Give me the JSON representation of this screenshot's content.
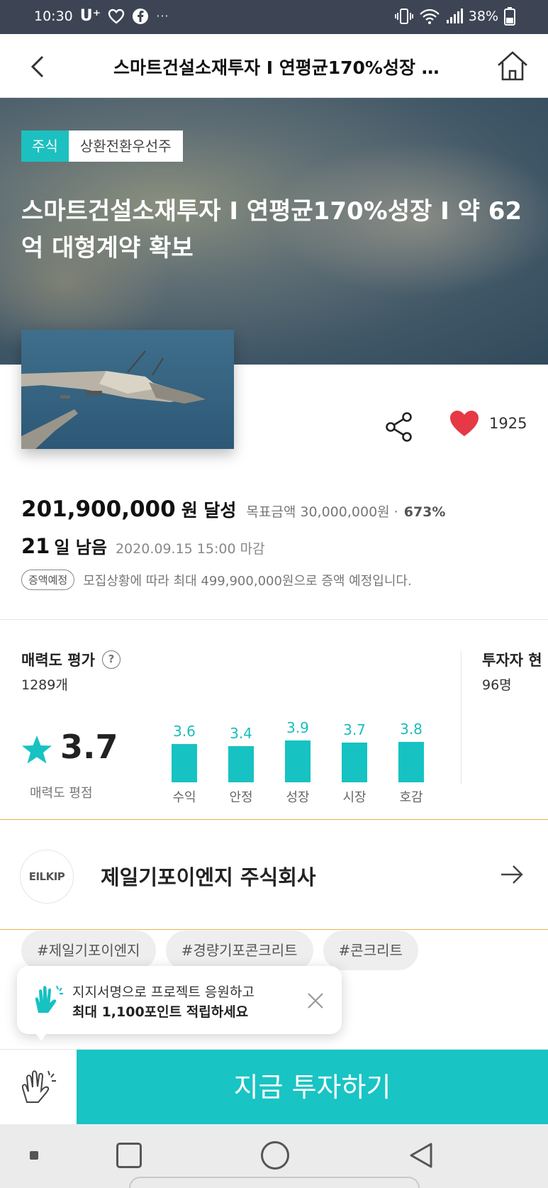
{
  "status_bar": {
    "time": "10:30",
    "carrier": "U⁺",
    "overflow": "···",
    "battery": "38%",
    "icons": [
      "heart-icon",
      "facebook-icon",
      "vibrate-icon",
      "wifi-icon",
      "signal-icon",
      "battery-icon"
    ]
  },
  "nav": {
    "title": "스마트건설소재투자 I 연평균170%성장 I 약 62억 대형계약 확보",
    "back_icon": "chevron-left-icon",
    "home_icon": "home-icon"
  },
  "hero": {
    "tag_stock": "주식",
    "tag_type": "상환전환우선주",
    "title": "스마트건설소재투자 I 연평균170%성장 I 약 62억 대형계약 확보"
  },
  "actions": {
    "like_count": "1925",
    "share_icon": "share-icon",
    "like_icon": "heart-icon"
  },
  "funding": {
    "raised_amount": "201,900,000",
    "raised_suffix": "원 달성",
    "target_label": "목표금액 30,000,000원 ·",
    "percent": "673%",
    "days_left": "21",
    "days_suffix": "일 남음",
    "deadline": "2020.09.15 15:00 마감",
    "note_badge": "증액예정",
    "note_text": "모집상황에 따라 최대 499,900,000원으로 증액 예정입니다."
  },
  "rating": {
    "title": "매력도 평가",
    "count": "1289개",
    "average": "3.7",
    "average_label": "매력도 평점",
    "max": 5,
    "categories": [
      {
        "label": "수익",
        "value": 3.6
      },
      {
        "label": "안정",
        "value": 3.4
      },
      {
        "label": "성장",
        "value": 3.9
      },
      {
        "label": "시장",
        "value": 3.7
      },
      {
        "label": "호감",
        "value": 3.8
      }
    ]
  },
  "investors": {
    "title": "투자자 현",
    "count": "96명"
  },
  "company": {
    "logo_text": "EILKIP",
    "name": "제일기포이엔지 주식회사",
    "arrow_icon": "arrow-right-icon"
  },
  "hashtags": [
    "#제일기포이엔지",
    "#경량기포콘크리트",
    "#콘크리트"
  ],
  "popup": {
    "line1": "지지서명으로 프로젝트 응원하고",
    "line2": "최대 1,100포인트 적립하세요"
  },
  "cta": {
    "invest_label": "지금 투자하기"
  },
  "colors": {
    "accent": "#19c4c4",
    "like": "#e63946",
    "company_border": "#e8b24a"
  }
}
